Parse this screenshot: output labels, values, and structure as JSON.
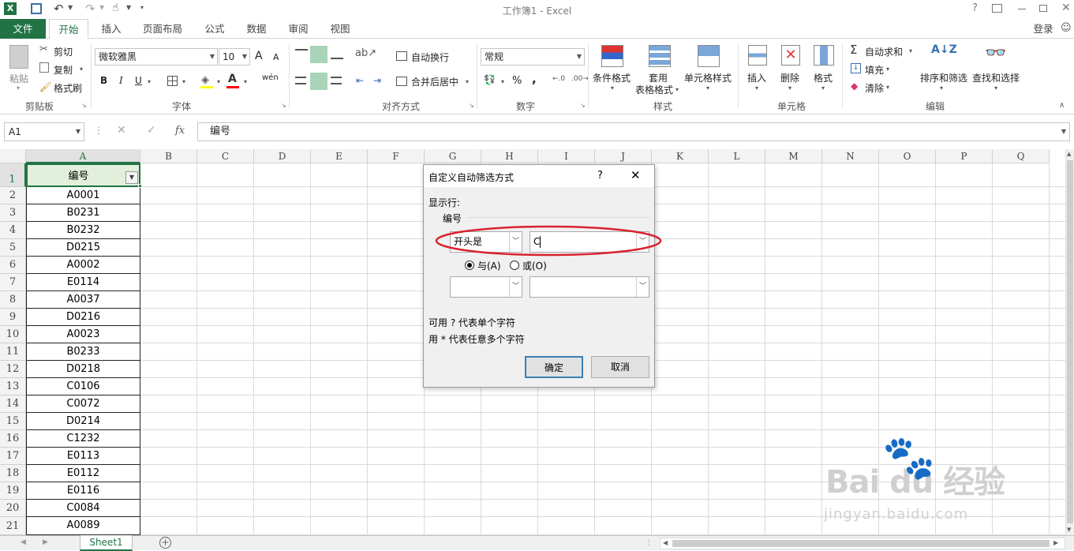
{
  "window": {
    "title": "工作簿1 - Excel",
    "login": "登录"
  },
  "tabs": [
    "文件",
    "开始",
    "插入",
    "页面布局",
    "公式",
    "数据",
    "审阅",
    "视图"
  ],
  "ribbon": {
    "clipboard": {
      "paste": "粘贴",
      "cut": "剪切",
      "copy": "复制",
      "format_painter": "格式刷",
      "group": "剪贴板"
    },
    "font": {
      "name": "微软雅黑",
      "size": "10",
      "bold": "B",
      "italic": "I",
      "underline": "U",
      "grow": "A",
      "shrink": "A",
      "phonetic": "wén",
      "group": "字体"
    },
    "alignment": {
      "wrap": "自动换行",
      "merge": "合并后居中",
      "group": "对齐方式"
    },
    "number": {
      "format": "常规",
      "percent": "%",
      "comma": ",",
      "group": "数字"
    },
    "styles": {
      "conditional": "条件格式",
      "table_line1": "套用",
      "table_line2": "表格格式",
      "cell_styles": "单元格样式",
      "group": "样式"
    },
    "cells": {
      "insert": "插入",
      "delete": "删除",
      "format": "格式",
      "group": "单元格"
    },
    "editing": {
      "autosum": "自动求和",
      "fill": "填充",
      "clear": "清除",
      "sort": "排序和筛选",
      "find": "查找和选择",
      "group": "编辑"
    }
  },
  "formula_bar": {
    "name_box": "A1",
    "fx": "fx",
    "content": "编号"
  },
  "columns": [
    "A",
    "B",
    "C",
    "D",
    "E",
    "F",
    "G",
    "H",
    "I",
    "J",
    "K",
    "L",
    "M",
    "N",
    "O",
    "P",
    "Q"
  ],
  "rows": [
    "1",
    "2",
    "3",
    "4",
    "5",
    "6",
    "7",
    "8",
    "9",
    "10",
    "11",
    "12",
    "13",
    "14",
    "15",
    "16",
    "17",
    "18",
    "19",
    "20",
    "21"
  ],
  "column_a": [
    "编号",
    "A0001",
    "B0231",
    "B0232",
    "D0215",
    "A0002",
    "E0114",
    "A0037",
    "D0216",
    "A0023",
    "B0233",
    "D0218",
    "C0106",
    "C0072",
    "D0214",
    "C1232",
    "E0113",
    "E0112",
    "E0116",
    "C0084",
    "A0089"
  ],
  "sheet_tab": "Sheet1",
  "dialog": {
    "title": "自定义自动筛选方式",
    "help": "?",
    "show_rows": "显示行:",
    "field": "编号",
    "op1": "开头是",
    "val1": "C",
    "and_label": "与(A)",
    "or_label": "或(O)",
    "op2": "",
    "val2": "",
    "hint1": "可用 ? 代表单个字符",
    "hint2": "用 * 代表任意多个字符",
    "ok": "确定",
    "cancel": "取消"
  },
  "watermark": {
    "brand": "Bai du 经验",
    "url": "jingyan.baidu.com"
  },
  "colors": {
    "excel_green": "#217346",
    "annotation_red": "#d9232e",
    "selected_tab_text": "#217346"
  }
}
